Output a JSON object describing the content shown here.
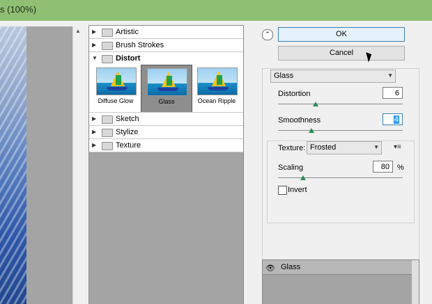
{
  "window": {
    "title": "s (100%)"
  },
  "filter_tree": {
    "folders": [
      {
        "label": "Artistic",
        "expanded": false
      },
      {
        "label": "Brush Strokes",
        "expanded": false
      },
      {
        "label": "Distort",
        "expanded": true
      },
      {
        "label": "Sketch",
        "expanded": false
      },
      {
        "label": "Stylize",
        "expanded": false
      },
      {
        "label": "Texture",
        "expanded": false
      }
    ],
    "distort_filters": [
      {
        "label": "Diffuse Glow",
        "selected": false
      },
      {
        "label": "Glass",
        "selected": true
      },
      {
        "label": "Ocean Ripple",
        "selected": false
      }
    ]
  },
  "buttons": {
    "ok": "OK",
    "cancel": "Cancel"
  },
  "settings": {
    "filter_select": "Glass",
    "distortion": {
      "label": "Distortion",
      "value": "6",
      "slider_fraction": 0.3
    },
    "smoothness": {
      "label": "Smoothness",
      "value": "4",
      "slider_fraction": 0.27
    },
    "texture": {
      "label": "Texture:",
      "value": "Frosted"
    },
    "scaling": {
      "label": "Scaling",
      "value": "80",
      "unit": "%",
      "slider_fraction": 0.2
    },
    "invert": {
      "label": "Invert",
      "checked": false
    }
  },
  "layers": {
    "items": [
      {
        "name": "Glass",
        "visible": true
      }
    ]
  },
  "colors": {
    "accent": "#3c7fb1",
    "slider": "#2e8b57",
    "titlebar": "#8fbf72"
  }
}
